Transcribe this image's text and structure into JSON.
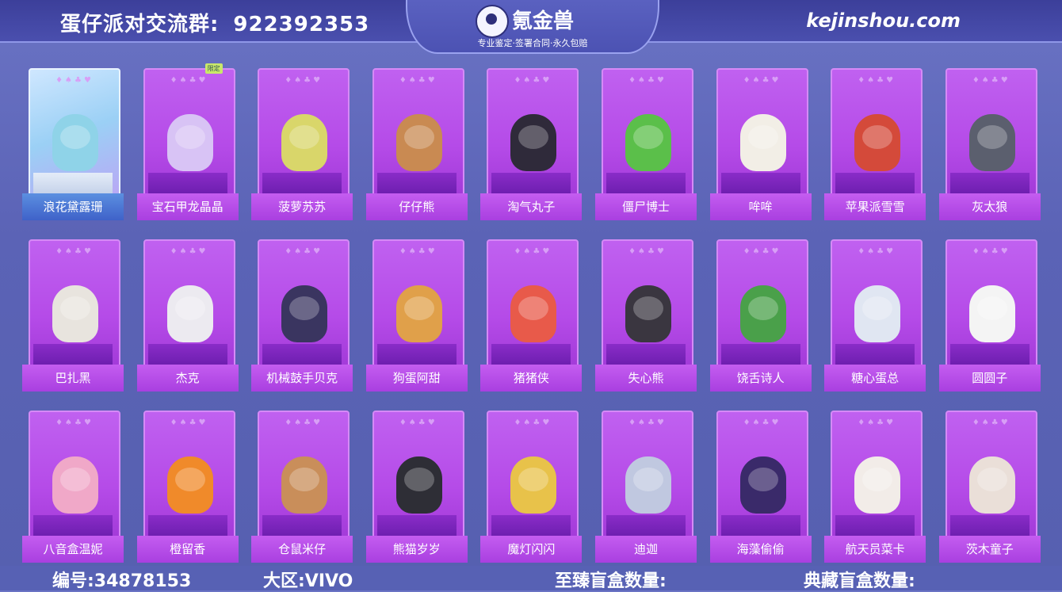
{
  "header": {
    "group_label": "蛋仔派对交流群:",
    "group_number": "922392353",
    "site": "kejinshou.com",
    "logo_name": "氪金兽",
    "logo_slogan": "专业鉴定·签署合同·永久包赔"
  },
  "cards": [
    {
      "name": "浪花黛露珊",
      "color": "#8fd3e8",
      "special": true
    },
    {
      "name": "宝石甲龙晶晶",
      "color": "#d8c3f5",
      "badge": "限定"
    },
    {
      "name": "菠萝苏苏",
      "color": "#d9d66a"
    },
    {
      "name": "仔仔熊",
      "color": "#c98a52"
    },
    {
      "name": "淘气丸子",
      "color": "#2f2a3a"
    },
    {
      "name": "僵尸博士",
      "color": "#5bbf4a"
    },
    {
      "name": "哞哞",
      "color": "#f2eee6"
    },
    {
      "name": "苹果派雪雪",
      "color": "#d44a3a"
    },
    {
      "name": "灰太狼",
      "color": "#5b5f6e"
    },
    {
      "name": "巴扎黑",
      "color": "#e8e4de"
    },
    {
      "name": "杰克",
      "color": "#eceaf0"
    },
    {
      "name": "机械鼓手贝克",
      "color": "#3a3560"
    },
    {
      "name": "狗蛋阿甜",
      "color": "#e0a04a"
    },
    {
      "name": "猪猪侠",
      "color": "#e85a4a"
    },
    {
      "name": "失心熊",
      "color": "#3a3640"
    },
    {
      "name": "饶舌诗人",
      "color": "#4aa04a"
    },
    {
      "name": "糖心蛋总",
      "color": "#e0e6f2"
    },
    {
      "name": "圆圆子",
      "color": "#f4f4f4"
    },
    {
      "name": "八音盒温妮",
      "color": "#f0a8c8"
    },
    {
      "name": "橙留香",
      "color": "#f08a2a"
    },
    {
      "name": "仓鼠米仔",
      "color": "#c98e5a"
    },
    {
      "name": "熊猫岁岁",
      "color": "#2e2e36"
    },
    {
      "name": "魔灯闪闪",
      "color": "#e8c24a"
    },
    {
      "name": "迪迦",
      "color": "#c0c8e0"
    },
    {
      "name": "海藻偷偷",
      "color": "#3a2a6a"
    },
    {
      "name": "航天员菜卡",
      "color": "#f2ece8"
    },
    {
      "name": "茨木童子",
      "color": "#eadfd8"
    }
  ],
  "footer": {
    "id_label": "编号:34878153",
    "region_label": "大区:VIVO",
    "supreme_label": "至臻盲盒数量:",
    "collection_label": "典藏盲盒数量:"
  }
}
